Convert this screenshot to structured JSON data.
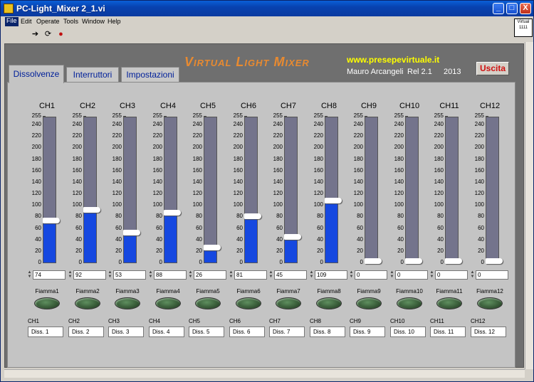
{
  "window": {
    "title": "PC-Light_Mixer 2_1.vi",
    "minimize": "_",
    "maximize": "□",
    "close": "X"
  },
  "menu": [
    "File",
    "Edit",
    "Operate",
    "Tools",
    "Window",
    "Help"
  ],
  "toolbar": {
    "run": "➔",
    "run_continuous": "⟳",
    "abort": "●"
  },
  "vilogo": "Virtual 1111",
  "header": {
    "title": "Virtual Light Mixer",
    "website": "www.presepevirtuale.it",
    "author": "Mauro Arcangeli",
    "release": "Rel 2.1",
    "year": "2013",
    "exit_label": "Uscita"
  },
  "tabs": [
    "Dissolvenze",
    "Interruttori",
    "Impostazioni"
  ],
  "scale_ticks": [
    "255",
    "240",
    "220",
    "200",
    "180",
    "160",
    "140",
    "120",
    "100",
    "80",
    "60",
    "40",
    "20",
    "0"
  ],
  "channels": [
    {
      "name": "CH1",
      "value": 74,
      "value_text": "74",
      "flame": "Fiamma1",
      "label": "CH1",
      "diss": "Diss. 1"
    },
    {
      "name": "CH2",
      "value": 92,
      "value_text": "92",
      "flame": "Fiamma2",
      "label": "CH2",
      "diss": "Diss. 2"
    },
    {
      "name": "CH3",
      "value": 53,
      "value_text": "53",
      "flame": "Fiamma3",
      "label": "CH3",
      "diss": "Diss. 3"
    },
    {
      "name": "CH4",
      "value": 88,
      "value_text": "88",
      "flame": "Fiamma4",
      "label": "CH4",
      "diss": "Diss. 4"
    },
    {
      "name": "CH5",
      "value": 26,
      "value_text": "26",
      "flame": "Fiamma5",
      "label": "CH5",
      "diss": "Diss. 5"
    },
    {
      "name": "CH6",
      "value": 81,
      "value_text": "81",
      "flame": "Fiamma6",
      "label": "CH6",
      "diss": "Diss. 6"
    },
    {
      "name": "CH7",
      "value": 45,
      "value_text": "45",
      "flame": "Fiamma7",
      "label": "CH7",
      "diss": "Diss. 7"
    },
    {
      "name": "CH8",
      "value": 109,
      "value_text": "109",
      "flame": "Fiamma8",
      "label": "CH8",
      "diss": "Diss. 8"
    },
    {
      "name": "CH9",
      "value": 0,
      "value_text": "0",
      "flame": "Fiamma9",
      "label": "CH9",
      "diss": "Diss. 9"
    },
    {
      "name": "CH10",
      "value": 0,
      "value_text": "0",
      "flame": "Fiamma10",
      "label": "CH10",
      "diss": "Diss. 10"
    },
    {
      "name": "CH11",
      "value": 0,
      "value_text": "0",
      "flame": "Fiamma11",
      "label": "CH11",
      "diss": "Diss. 11"
    },
    {
      "name": "CH12",
      "value": 0,
      "value_text": "0",
      "flame": "Fiamma12",
      "label": "CH12",
      "diss": "Diss. 12"
    }
  ],
  "colors": {
    "fill": "#1548e0",
    "track": "#74748c",
    "title": "#e88a30",
    "website": "#ffff00",
    "exit": "#d01010"
  }
}
